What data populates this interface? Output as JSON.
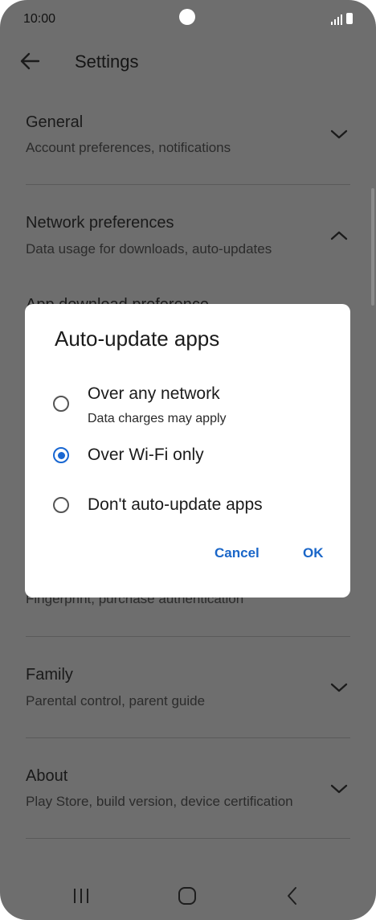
{
  "status_bar": {
    "time": "10:00"
  },
  "header": {
    "title": "Settings"
  },
  "settings": [
    {
      "title": "General",
      "subtitle": "Account preferences, notifications",
      "expanded": false
    },
    {
      "title": "Network preferences",
      "subtitle": "Data usage for downloads, auto-updates",
      "expanded": true
    },
    {
      "title": "App download preference",
      "subtitle": ""
    },
    {
      "title": "",
      "subtitle": "Fingerprint, purchase authentication"
    },
    {
      "title": "Family",
      "subtitle": "Parental control, parent guide",
      "expanded": false
    },
    {
      "title": "About",
      "subtitle": "Play Store, build version, device certification",
      "expanded": false
    }
  ],
  "dialog": {
    "title": "Auto-update apps",
    "options": [
      {
        "label": "Over any network",
        "sub": "Data charges may apply",
        "selected": false
      },
      {
        "label": "Over Wi-Fi only",
        "sub": "",
        "selected": true
      },
      {
        "label": "Don't auto-update apps",
        "sub": "",
        "selected": false
      }
    ],
    "cancel_label": "Cancel",
    "ok_label": "OK"
  },
  "colors": {
    "scrim": "#6e6e6e",
    "accent": "#1967d2",
    "dialog_bg": "#ffffff"
  },
  "icons": [
    "back-arrow-icon",
    "chevron-down-icon",
    "chevron-up-icon",
    "recent-apps-icon",
    "home-icon",
    "back-nav-icon"
  ]
}
